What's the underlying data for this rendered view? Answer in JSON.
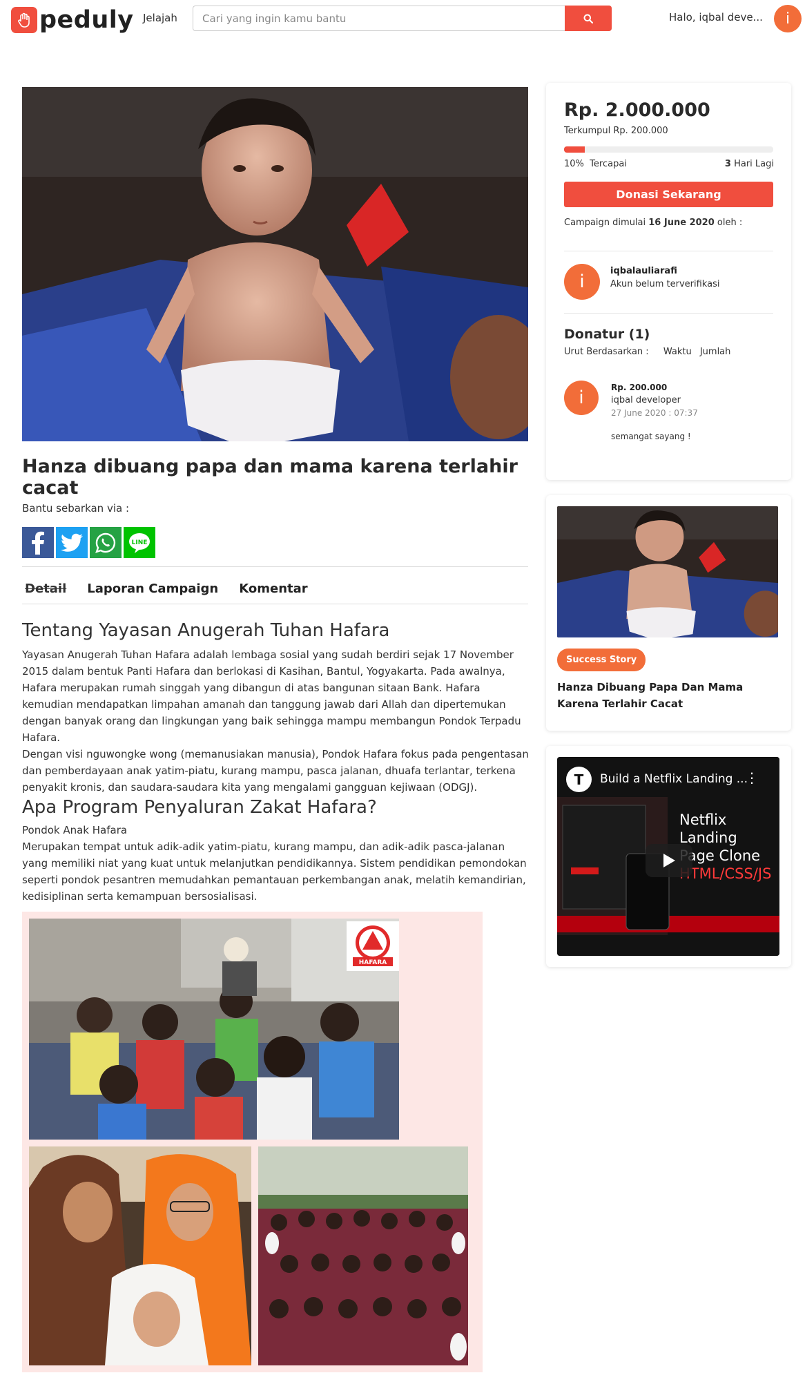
{
  "brand": {
    "name": "peduly",
    "accent": "#f04e3e",
    "avatar_color": "#f26d39"
  },
  "nav": {
    "explore": "Jelajah",
    "search_placeholder": "Cari yang ingin kamu bantu",
    "greeting": "Halo, iqbal deve...",
    "avatar_initial": "i"
  },
  "campaign": {
    "title": "Hanza dibuang papa dan mama karena terlahir cacat",
    "share_label": "Bantu sebarkan via :",
    "share_icons": [
      "facebook-icon",
      "twitter-icon",
      "whatsapp-icon",
      "line-icon"
    ],
    "tabs": [
      "Detail",
      "Laporan Campaign",
      "Komentar"
    ]
  },
  "content": {
    "h1": "Tentang Yayasan Anugerah Tuhan Hafara",
    "p1": "Yayasan Anugerah Tuhan Hafara adalah lembaga sosial yang sudah berdiri sejak 17 November 2015 dalam bentuk Panti Hafara dan berlokasi di Kasihan, Bantul, Yogyakarta. Pada awalnya, Hafara merupakan rumah singgah yang dibangun di atas bangunan sitaan Bank. Hafara kemudian mendapatkan limpahan amanah dan tanggung jawab dari Allah dan dipertemukan dengan banyak orang dan lingkungan yang baik sehingga mampu membangun Pondok Terpadu Hafara.",
    "p2": "Dengan visi nguwongke wong (memanusiakan manusia), Pondok Hafara fokus pada pengentasan dan pemberdayaan anak yatim-piatu, kurang mampu, pasca jalanan, dhuafa terlantar, terkena penyakit kronis, dan saudara-saudara kita yang mengalami gangguan kejiwaan (ODGJ).",
    "h2": "Apa Program Penyaluran Zakat Hafara?",
    "sub": "Pondok Anak Hafara",
    "p3": "Merupakan tempat untuk adik-adik yatim-piatu, kurang mampu, dan adik-adik pasca-jalanan yang memiliki niat yang kuat untuk melanjutkan pendidikannya. Sistem pendidikan pemondokan seperti pondok pesantren memudahkan pemantauan perkembangan anak, melatih kemandirian, kedisiplinan serta kemampuan bersosialisasi.",
    "logo_text": "HAFARA"
  },
  "donation": {
    "goal": "Rp. 2.000.000",
    "collected": "Terkumpul Rp. 200.000",
    "percent": 10,
    "percent_label": "10%",
    "reached_label": "Tercapai",
    "days_left": "3",
    "days_label": "Hari Lagi",
    "button": "Donasi Sekarang",
    "started_prefix": "Campaign dimulai",
    "started_date": "16 June 2020",
    "started_suffix": "oleh :",
    "organizer": "iqbalauliarafi",
    "organizer_status": "Akun belum terverifikasi",
    "organizer_initial": "i"
  },
  "donors": {
    "title": "Donatur (1)",
    "sort_label": "Urut Berdasarkan :",
    "sort_options": [
      "Waktu",
      "Jumlah"
    ],
    "list": [
      {
        "initial": "i",
        "amount": "Rp. 200.000",
        "name": "iqbal developer",
        "date": "27 June 2020 : 07:37",
        "message": "semangat sayang !"
      }
    ]
  },
  "story": {
    "badge": "Success Story",
    "title": "Hanza Dibuang Papa Dan Mama Karena Terlahir Cacat"
  },
  "video": {
    "title": "Build a Netflix Landing ...",
    "overlay_line1": "Netflix Landing",
    "overlay_line2": "Page Clone",
    "overlay_line3": "HTML/CSS/JS",
    "logo_letter": "T"
  }
}
